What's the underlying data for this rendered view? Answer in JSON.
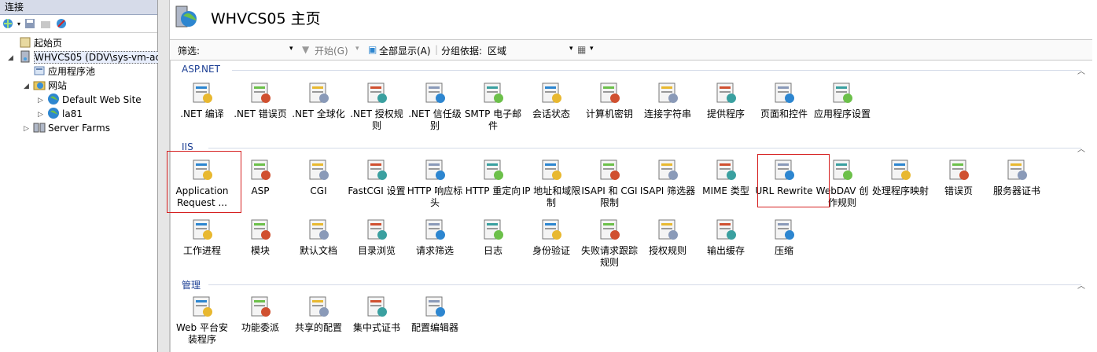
{
  "left_pane": {
    "title": "连接",
    "tree": [
      {
        "label": "起始页",
        "icon": "start-page-icon"
      },
      {
        "label": "WHVCS05 (DDV\\sys-vm-ac",
        "icon": "server-icon",
        "selected": true
      },
      {
        "label": "应用程序池",
        "icon": "app-pool-icon"
      },
      {
        "label": "网站",
        "icon": "sites-folder-icon"
      },
      {
        "label": "Default Web Site",
        "icon": "globe-icon"
      },
      {
        "label": "la81",
        "icon": "globe-icon"
      },
      {
        "label": "Server Farms",
        "icon": "server-farms-icon"
      }
    ]
  },
  "main": {
    "title": "WHVCS05 主页",
    "filter": {
      "label": "筛选:",
      "start_label": "开始(G)",
      "show_all_label": "全部显示(A)",
      "group_by_label": "分组依据:",
      "group_by_value": "区域"
    },
    "groups": {
      "aspnet": {
        "title": "ASP.NET",
        "items": [
          ".NET 编译",
          ".NET 错误页",
          ".NET 全球化",
          ".NET 授权规则",
          ".NET 信任级别",
          "SMTP 电子邮件",
          "会话状态",
          "计算机密钥",
          "连接字符串",
          "提供程序",
          "页面和控件",
          "应用程序设置"
        ]
      },
      "iis": {
        "title": "IIS",
        "items_row1": [
          "Application Request ...",
          "ASP",
          "CGI",
          "FastCGI 设置",
          "HTTP 响应标头",
          "HTTP 重定向",
          "IP 地址和域限制",
          "ISAPI 和 CGI 限制",
          "ISAPI 筛选器",
          "MIME 类型",
          "URL Rewrite",
          "WebDAV 创作规则",
          "处理程序映射",
          "错误页",
          "服务器证书"
        ],
        "items_row2": [
          "工作进程",
          "模块",
          "默认文档",
          "目录浏览",
          "请求筛选",
          "日志",
          "身份验证",
          "失败请求跟踪规则",
          "授权规则",
          "输出缓存",
          "压缩"
        ]
      },
      "mgmt": {
        "title": "管理",
        "items": [
          "Web 平台安装程序",
          "功能委派",
          "共享的配置",
          "集中式证书",
          "配置编辑器"
        ]
      }
    },
    "highlight_color": "#d62020",
    "group_color": "#1c3f94"
  }
}
